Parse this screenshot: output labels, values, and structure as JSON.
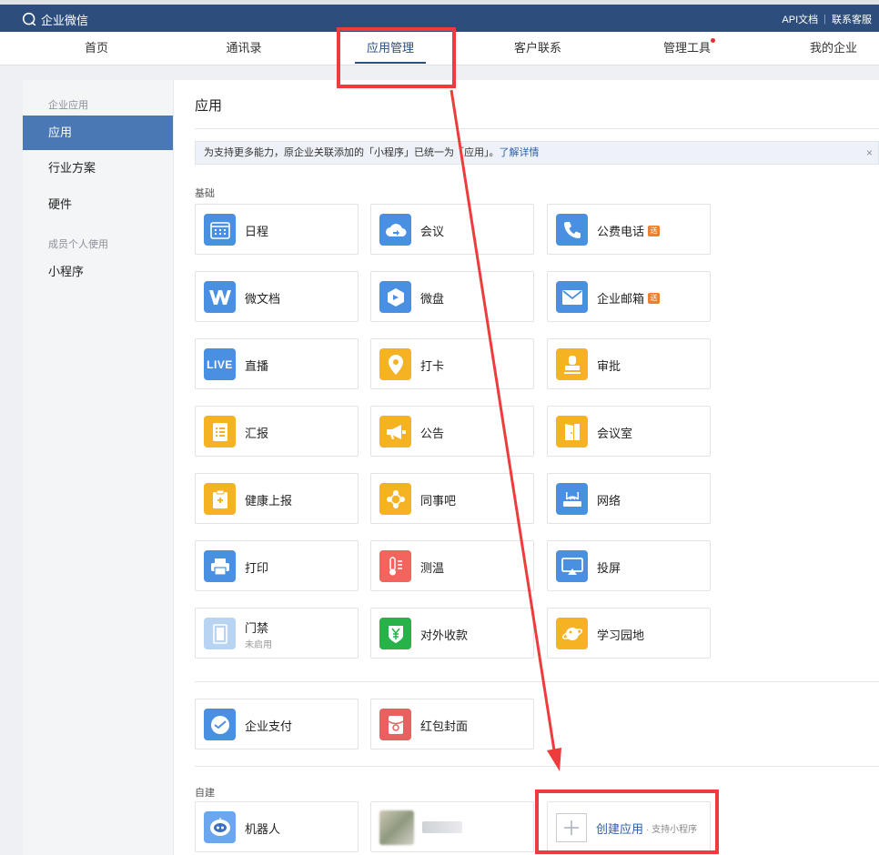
{
  "header": {
    "logo_text": "企业微信",
    "api_docs": "API文档",
    "separator": "|",
    "support": "联系客服"
  },
  "nav": {
    "items": [
      "首页",
      "通讯录",
      "应用管理",
      "客户联系",
      "管理工具",
      "我的企业"
    ],
    "active": "应用管理"
  },
  "sidebar": {
    "group1": "企业应用",
    "items": [
      "应用",
      "行业方案",
      "硬件"
    ],
    "group2": "成员个人使用",
    "items2": [
      "小程序"
    ]
  },
  "main": {
    "title": "应用",
    "notice_text": "为支持更多能力，原企业关联添加的「小程序」已统一为「应用」。",
    "notice_link": "了解详情",
    "notice_close": "×",
    "section_basic": "基础",
    "section_custom": "自建",
    "apps": {
      "schedule": "日程",
      "meeting": "会议",
      "phone": "公费电话",
      "doc": "微文档",
      "disk": "微盘",
      "mail": "企业邮箱",
      "live": "直播",
      "checkin": "打卡",
      "approval": "审批",
      "report": "汇报",
      "notice": "公告",
      "meeting_room": "会议室",
      "health": "健康上报",
      "colleague": "同事吧",
      "network": "网络",
      "print": "打印",
      "temperature": "测温",
      "screencast": "投屏",
      "door": "门禁",
      "door_status": "未启用",
      "payment_collect": "对外收款",
      "study": "学习园地",
      "enterprise_pay": "企业支付",
      "red_packet": "红包封面",
      "robot": "机器人"
    },
    "badge_label": "送",
    "live_icon_text": "LIVE",
    "create_app": "创建应用",
    "create_app_sub": "· 支持小程序"
  },
  "colors": {
    "header_bg": "#2d4e7d",
    "accent": "#4a78b5",
    "annotation": "#ee3c3c"
  }
}
